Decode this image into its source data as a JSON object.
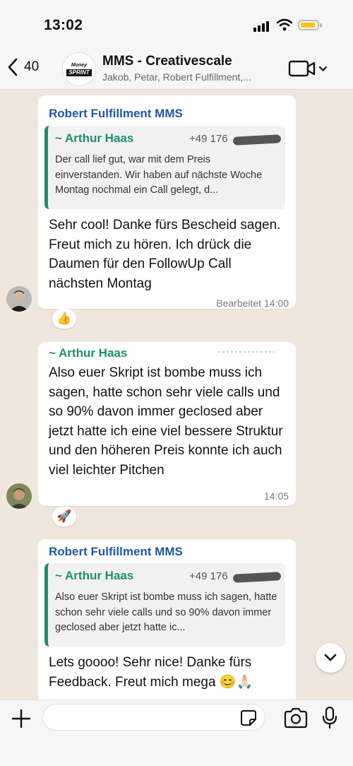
{
  "status_bar": {
    "time": "13:02"
  },
  "header": {
    "back_count": "40",
    "group_avatar_line1": "Money",
    "group_avatar_line2": "SPRINT",
    "title": "MMS - Creativescale",
    "subtitle": "Jakob, Petar, Robert Fulfillment,..."
  },
  "messages": [
    {
      "sender": "Robert Fulfillment MMS",
      "quote_author": "~ Arthur Haas",
      "quote_phone": "+49 176",
      "quote_text": "Der call lief gut, war mit dem Preis einverstanden. Wir haben auf nächste Woche Montag nochmal ein Call gelegt, d...",
      "text": "Sehr cool! Danke fürs Bescheid sagen. Freut mich zu hören. Ich drück die Daumen für den FollowUp Call nächsten Montag",
      "meta": "Bearbeitet 14:00",
      "reaction": "👍"
    },
    {
      "author": "~ Arthur Haas",
      "text": "Also euer Skript ist bombe muss ich sagen, hatte schon sehr viele calls und so 90% davon immer geclosed aber jetzt hatte ich eine viel bessere Struktur und den höheren Preis konnte ich auch viel leichter Pitchen",
      "meta": "14:05",
      "reaction": "🚀"
    },
    {
      "sender": "Robert Fulfillment MMS",
      "quote_author": "~ Arthur Haas",
      "quote_phone": "+49 176",
      "quote_text": "Also euer Skript ist bombe muss ich sagen, hatte schon sehr viele calls und so 90% davon immer geclosed aber jetzt hatte ic...",
      "text": "Lets goooo! Sehr nice! Danke fürs Feedback. Freut mich mega 😊🙏🏻"
    }
  ],
  "colors": {
    "sender": "#1f57a8",
    "author": "#1e8f6e",
    "background": "#efe7db",
    "battery": "#f5c518"
  },
  "icons": [
    "chevron-left-icon",
    "video-call-icon",
    "chevron-down-icon",
    "plus-icon",
    "sticker-icon",
    "camera-icon",
    "microphone-icon"
  ]
}
